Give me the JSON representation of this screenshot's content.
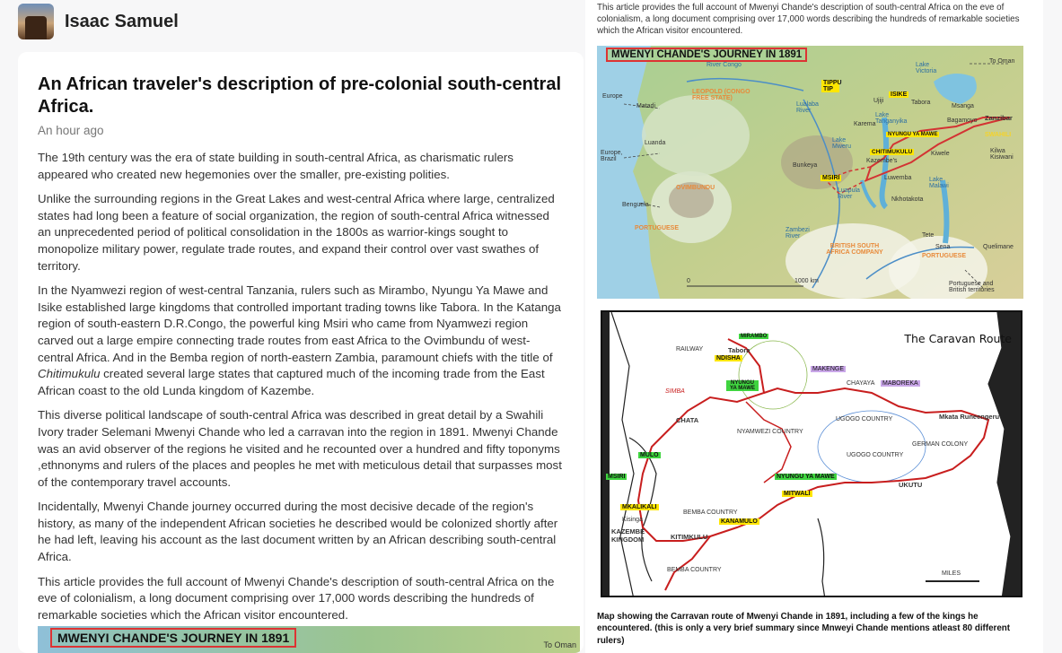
{
  "header": {
    "author": "Isaac Samuel"
  },
  "article": {
    "title": "An African traveler's description of pre-colonial south-central Africa.",
    "time": "An hour ago",
    "p1": "The 19th century was the era of state building in south-central Africa, as charismatic rulers appeared who created new hegemonies over the smaller, pre-existing polities.",
    "p2": "Unlike the surrounding regions in the Great Lakes and west-central Africa where large, centralized states had long been a feature of social organization, the region of south-central Africa witnessed an unprecedented period of political consolidation in the 1800s as warrior-kings sought to monopolize military power, regulate trade routes, and expand their control over vast swathes of territory.",
    "p3_before": "In the Nyamwezi region of west-central Tanzania, rulers such as Mirambo, Nyungu Ya Mawe and Isike established large kingdoms that controlled important trading towns like Tabora. In the Katanga region of south-eastern D.R.Congo, the powerful king Msiri who came from Nyamwezi region carved out a large empire connecting trade routes from east Africa to the Ovimbundu of west-central Africa. And in the Bemba region of north-eastern Zambia, paramount chiefs with the title of ",
    "p3_em": "Chitimukulu",
    "p3_after": " created several large states that captured much of the incoming trade from the East African coast to the old Lunda kingdom of Kazembe.",
    "p4": "This diverse political landscape of south-central Africa was described in great detail by a Swahili Ivory trader Selemani Mwenyi Chande who led a carravan into the region in 1891. Mwenyi Chande was an avid observer of the regions he visited and he recounted over a hundred and fifty toponyms ,ethnonyms and rulers of the places and peoples he met with meticulous detail that surpasses most of the contemporary travel accounts.",
    "p5": "Incidentally, Mwenyi Chande journey occurred during the most decisive decade of the region's history, as many of the independent African societies he described would be colonized shortly after he had left, leaving his account as the last document written by an African describing south-central Africa.",
    "p6": "This article provides the full account of Mwenyi Chande's description of south-central Africa on the eve of colonialism, a long document comprising over 17,000 words describing the hundreds of remarkable societies which the African visitor encountered.",
    "teaser_title": "MWENYI CHANDE'S JOURNEY IN 1891",
    "teaser_right": "To Oman"
  },
  "sidebar": {
    "caption_top": "This article provides the full account of Mwenyi Chande's description of south-central Africa on the eve of colonialism, a long document comprising over 17,000 words describing the hundreds of remarkable societies which the African visitor encountered.",
    "map1": {
      "title": "MWENYI CHANDE'S JOURNEY IN 1891",
      "labels": {
        "river_congo": "River Congo",
        "to_oman": "To Oman",
        "lake_victoria": "Lake Victoria",
        "europe1": "Europe",
        "matadi": "Matadi",
        "leopold": "LEOPOLD (CONGO FREE STATE)",
        "tippu": "TIPPU TIP",
        "lualaba": "Lualaba River",
        "ujiji": "Ujiji",
        "isike": "ISIKE",
        "tabora": "Tabora",
        "msanga": "Msanga",
        "zanzibar": "Zanzibar",
        "karema": "Karema",
        "lake_tanganyika": "Lake Tanganyika",
        "bagamoyo": "Bagamoyo",
        "swahili": "SWAHILI",
        "nyungu": "NYUNGU YA MAWE",
        "luanda": "Luanda",
        "europe2": "Europe, Brazil",
        "lake_mweru": "Lake Mweru",
        "chitimukulu": "CHITIMUKULU",
        "kazembe": "Kazembe's",
        "kiwele": "Kiwele",
        "kilwa": "Kilwa Kisiwani",
        "bunkeya": "Bunkeya",
        "msiri": "MSIRI",
        "luwemba": "Luwemba",
        "lake_malawi": "Lake Malawi",
        "ovimbundu": "OVIMBUNDU",
        "luapula": "Luapula River",
        "nkhotakota": "Nkhotakota",
        "benguela": "Benguela",
        "portuguese": "PORTUGUESE",
        "zambezi": "Zambezi River",
        "tete": "Tete",
        "bsac": "BRITISH SOUTH AFRICA COMPANY",
        "sena": "Sena",
        "portuguese2": "PORTUGUESE",
        "quelimane": "Quelimane",
        "scale_0": "0",
        "scale_1000": "1000 km",
        "portuguese_british": "Portuguese and British territories"
      }
    },
    "map2": {
      "title": "The Caravan Route",
      "labels": {
        "mirambo": "MIRAMBO",
        "railway": "RAILWAY",
        "tabora": "Tabora",
        "ndisha": "NDISHA",
        "nyungu": "NYUNGU YA MAWE",
        "simba": "SIMBA",
        "makenge": "MAKENGE",
        "chayaya": "CHAYAYA",
        "maboreka": "MABOREKA",
        "chata": "CHATA",
        "nyamwezi": "NYAMWEZI COUNTRY",
        "ugogo1": "UGOGO COUNTRY",
        "german": "GERMAN COLONY",
        "mkata": "Mkata Runeengeru",
        "ugogo2": "UGOGO COUNTRY",
        "mulo": "MULO",
        "msiri": "MSIRI",
        "nyungu2": "NYUNGU YA MAWE",
        "mitwali": "MITWALI",
        "ukutu": "UKUTU",
        "mkalikali": "MKALIKALI",
        "bemba1": "BEMBA COUNTRY",
        "kanamulo": "KANAMULO",
        "kazembe": "KAZEMBE KINGDOM",
        "kitimkulu": "KITIMKULU",
        "bemba2": "BEMBA COUNTRY",
        "kisinga": "Kisinga",
        "miles": "MILES"
      }
    },
    "caption_bottom": "Map showing the Carravan route of Mwenyi Chande in 1891, including a few of the kings he encountered. (this is only a very brief summary since Mnweyi Chande mentions atleast 80 different rulers)"
  },
  "colors": {
    "accent_red": "#d33333",
    "highlight_yellow": "#ffe600",
    "highlight_green": "#3fd43f"
  }
}
